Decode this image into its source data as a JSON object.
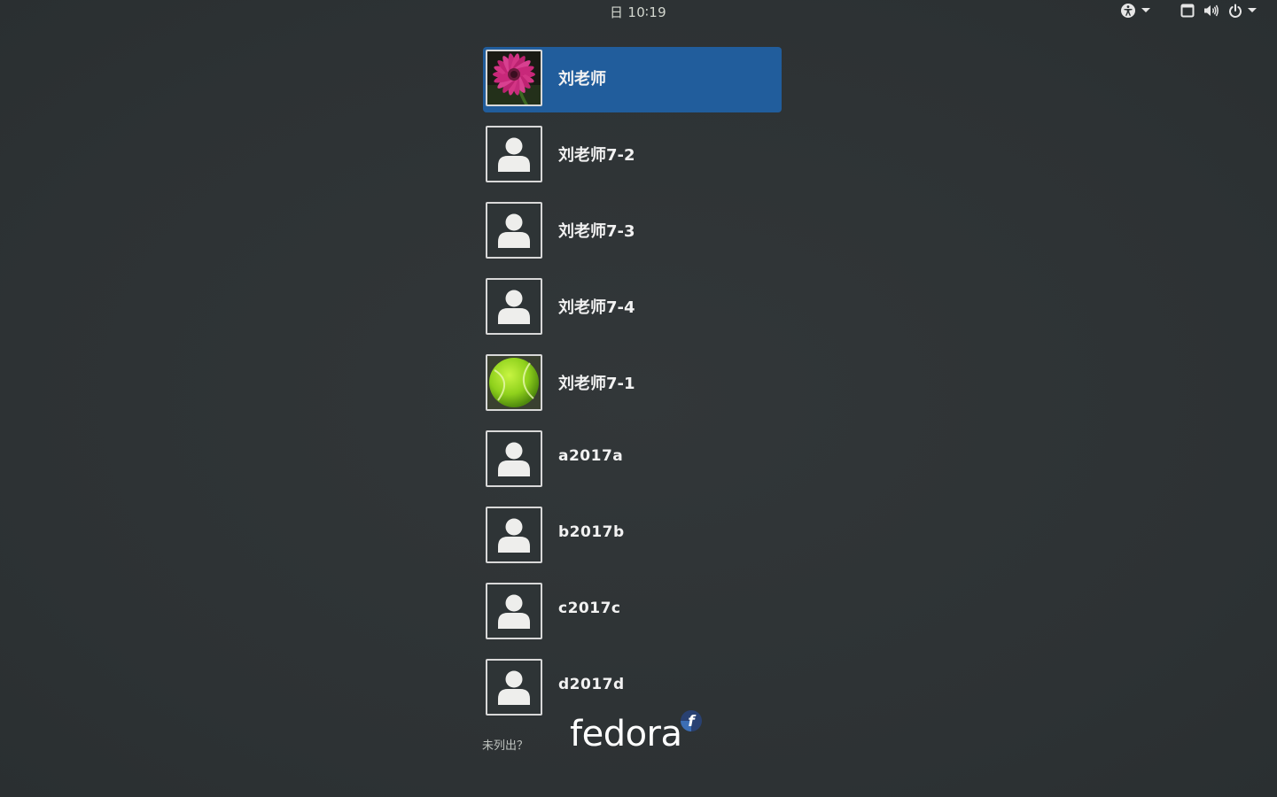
{
  "topbar": {
    "clock": "日 10∶19",
    "icons": [
      "accessibility-icon",
      "chevron-down-icon",
      "display-icon",
      "volume-icon",
      "power-icon",
      "chevron-down-icon"
    ]
  },
  "users": [
    {
      "name": "刘老师",
      "avatar": "flower",
      "selected": true
    },
    {
      "name": "刘老师7-2",
      "avatar": "default"
    },
    {
      "name": "刘老师7-3",
      "avatar": "default"
    },
    {
      "name": "刘老师7-4",
      "avatar": "default"
    },
    {
      "name": "刘老师7-1",
      "avatar": "tennis-ball"
    },
    {
      "name": "a2017a",
      "avatar": "default"
    },
    {
      "name": "b2017b",
      "avatar": "default"
    },
    {
      "name": "c2017c",
      "avatar": "default"
    },
    {
      "name": "d2017d",
      "avatar": "default"
    }
  ],
  "not_listed": "未列出？",
  "logo": {
    "text": "fedora",
    "badge_letter": "f"
  },
  "colors": {
    "background": "#2e3436",
    "selected": "#215d9c",
    "logo_blue": "#294172",
    "logo_light_blue": "#3c6eb4"
  }
}
